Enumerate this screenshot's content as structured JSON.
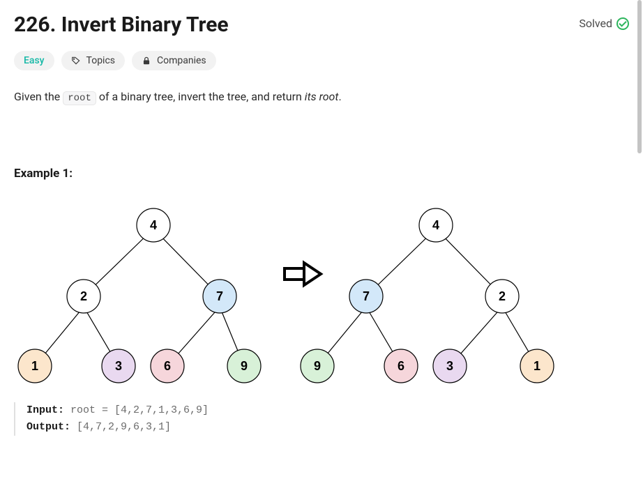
{
  "header": {
    "title": "226. Invert Binary Tree",
    "solved_label": "Solved"
  },
  "chips": {
    "difficulty": "Easy",
    "topics": "Topics",
    "companies": "Companies"
  },
  "description": {
    "prefix": "Given the ",
    "code": "root",
    "mid": " of a binary tree, invert the tree, and return ",
    "italic": "its root",
    "suffix": "."
  },
  "example": {
    "heading": "Example 1:",
    "input_label": "Input:",
    "input_value": " root = [4,2,7,1,3,6,9]",
    "output_label": "Output:",
    "output_value": " [4,7,2,9,6,3,1]"
  },
  "tree_nodes": {
    "left_root": "4",
    "left_l": "2",
    "left_r": "7",
    "left_ll": "1",
    "left_lr": "3",
    "left_rl": "6",
    "left_rr": "9",
    "right_root": "4",
    "right_l": "7",
    "right_r": "2",
    "right_ll": "9",
    "right_lr": "6",
    "right_rl": "3",
    "right_rr": "1"
  },
  "colors": {
    "white": "#ffffff",
    "blue": "#d3e8f9",
    "green": "#d8f1d8",
    "purple": "#e9d9f0",
    "pink": "#f6d6db",
    "orange": "#fce6cc"
  }
}
